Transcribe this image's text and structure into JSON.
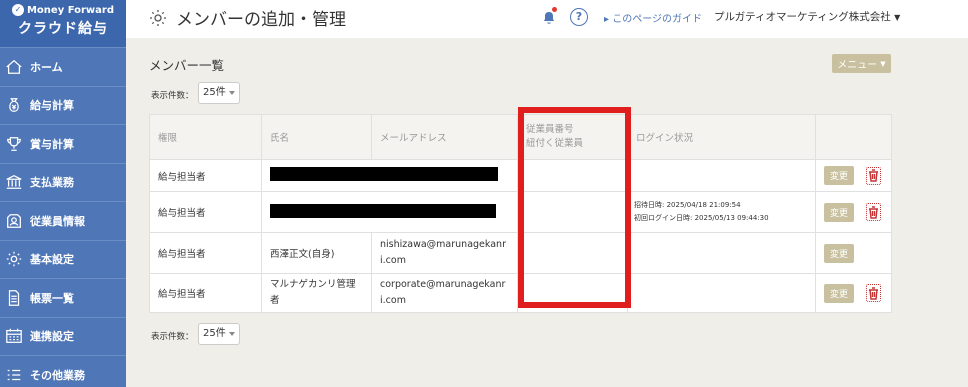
{
  "sidebar": {
    "brand_top": "Money Forward",
    "brand_main": "クラウド給与",
    "items": [
      {
        "label": "ホーム",
        "icon": "home-icon"
      },
      {
        "label": "給与計算",
        "icon": "money-bag-icon"
      },
      {
        "label": "賞与計算",
        "icon": "trophy-icon"
      },
      {
        "label": "支払業務",
        "icon": "bank-icon"
      },
      {
        "label": "従業員情報",
        "icon": "employee-icon"
      },
      {
        "label": "基本設定",
        "icon": "gear-icon"
      },
      {
        "label": "帳票一覧",
        "icon": "document-icon"
      },
      {
        "label": "連携設定",
        "icon": "calendar-grid-icon"
      },
      {
        "label": "その他業務",
        "icon": "list-icon"
      }
    ]
  },
  "header": {
    "title": "メンバーの追加・管理",
    "guide_link": "このページのガイド",
    "company": "プルガティオマーケティング株式会社",
    "help_glyph": "?"
  },
  "main": {
    "section_title": "メンバー一覧",
    "menu_button": "メニュー",
    "pager_label": "表示件数：",
    "pager_value": "25件",
    "columns": [
      "権限",
      "氏名",
      "メールアドレス",
      "従業員番号\n紐付く従業員",
      "ログイン状況",
      ""
    ],
    "rows": [
      {
        "role": "給与担当者",
        "name": "",
        "email": "",
        "employee": "",
        "login1": "",
        "login2": "",
        "action": "変更",
        "redacted": true
      },
      {
        "role": "給与担当者",
        "name": "",
        "email": "",
        "employee": "",
        "login1": "招待日時: 2025/04/18 21:09:54",
        "login2": "初回ログイン日時: 2025/05/13 09:44:30",
        "action": "変更",
        "redacted": true
      },
      {
        "role": "給与担当者",
        "name": "西澤正文(自身)",
        "email": "nishizawa@marunagekanri.com",
        "employee": "",
        "login1": "",
        "login2": "",
        "action": "変更",
        "redacted": false
      },
      {
        "role": "給与担当者",
        "name": "マルナゲカンリ管理者",
        "email": "corporate@marunagekanri.com",
        "employee": "",
        "login1": "",
        "login2": "",
        "action": "変更",
        "redacted": false
      }
    ]
  },
  "colors": {
    "sidebar": "#4f76b7",
    "accent_button": "#c9c0a0",
    "highlight": "#e11e1e",
    "delete": "#c23333"
  }
}
